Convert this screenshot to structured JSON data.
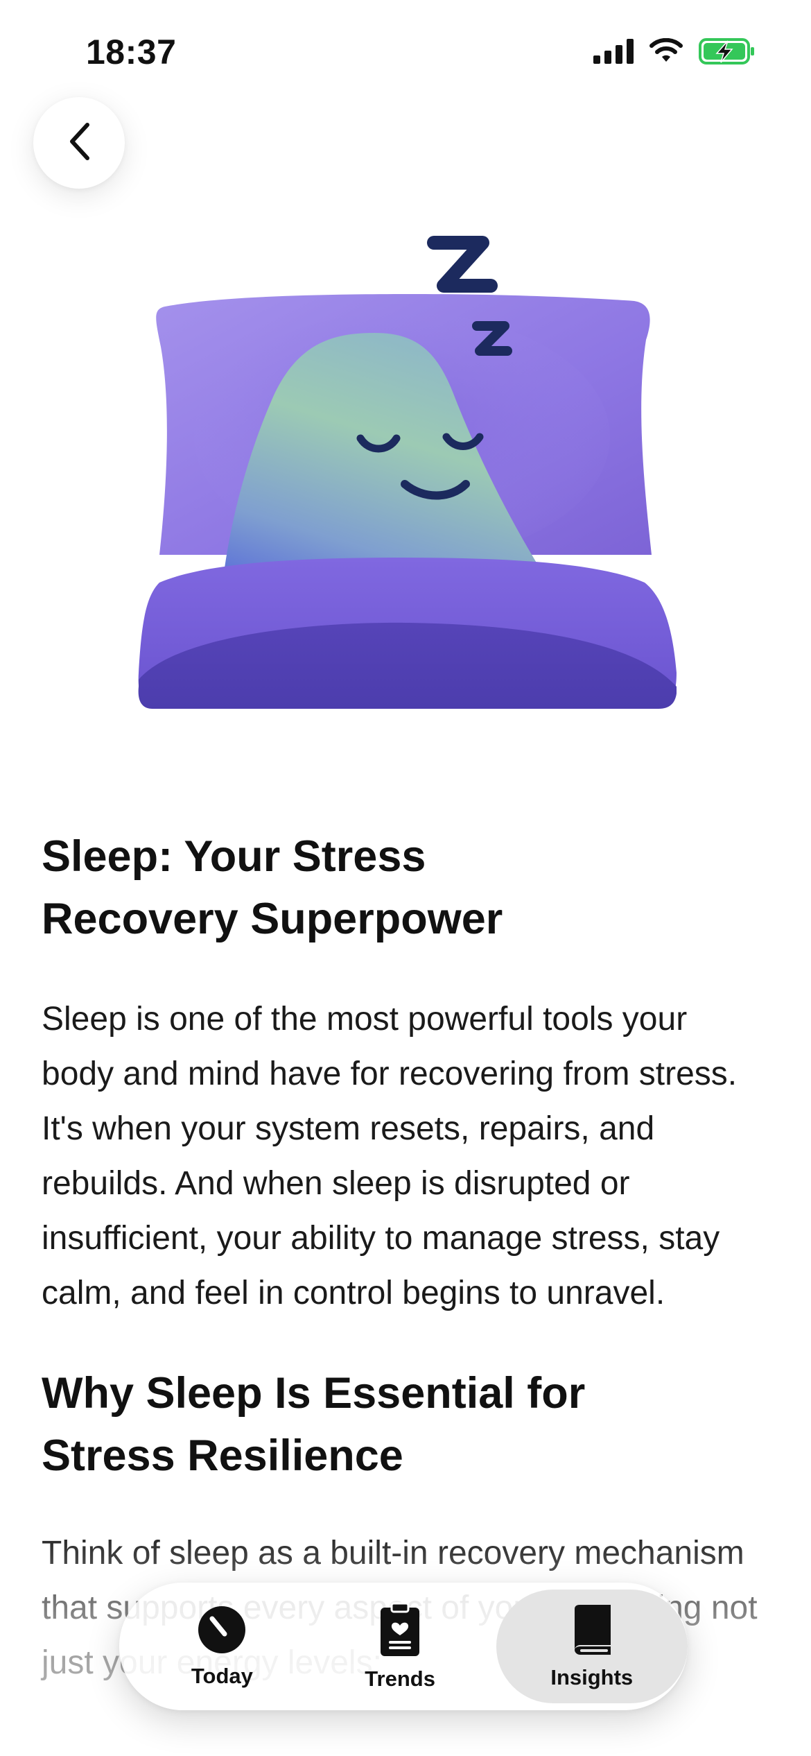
{
  "status_bar": {
    "time": "18:37",
    "icons": [
      "signal-icon",
      "wifi-icon",
      "battery-charging-icon"
    ],
    "battery_color": "#34c759"
  },
  "nav": {
    "back_icon": "chevron-left-icon"
  },
  "illustration": {
    "icon": "sleeping-character-on-pillow",
    "colors": {
      "pillow": "#8f7ae6",
      "blanket": "#5e4bc7",
      "character_top": "#9fc9b8",
      "character_bottom": "#6b7fd6",
      "face": "#1c2a5e"
    }
  },
  "article": {
    "title": "Sleep: Your Stress Recovery Superpower",
    "intro": "Sleep is one of the most powerful tools your body and mind have for recovering from stress. It's when your system resets, repairs, and rebuilds. And when sleep is disrupted or insufficient, your ability to manage stress, stay calm, and feel in control begins to unravel.",
    "section_title": "Why Sleep Is Essential for Stress Resilience",
    "section_text": "Think of sleep as a built-in recovery mechanism that supports every aspect of your well-being not just your energy levels:"
  },
  "tab_bar": {
    "tabs": [
      {
        "label": "Today",
        "icon": "gauge-icon",
        "active": false
      },
      {
        "label": "Trends",
        "icon": "clipboard-heart-icon",
        "active": false
      },
      {
        "label": "Insights",
        "icon": "book-icon",
        "active": true
      }
    ]
  }
}
